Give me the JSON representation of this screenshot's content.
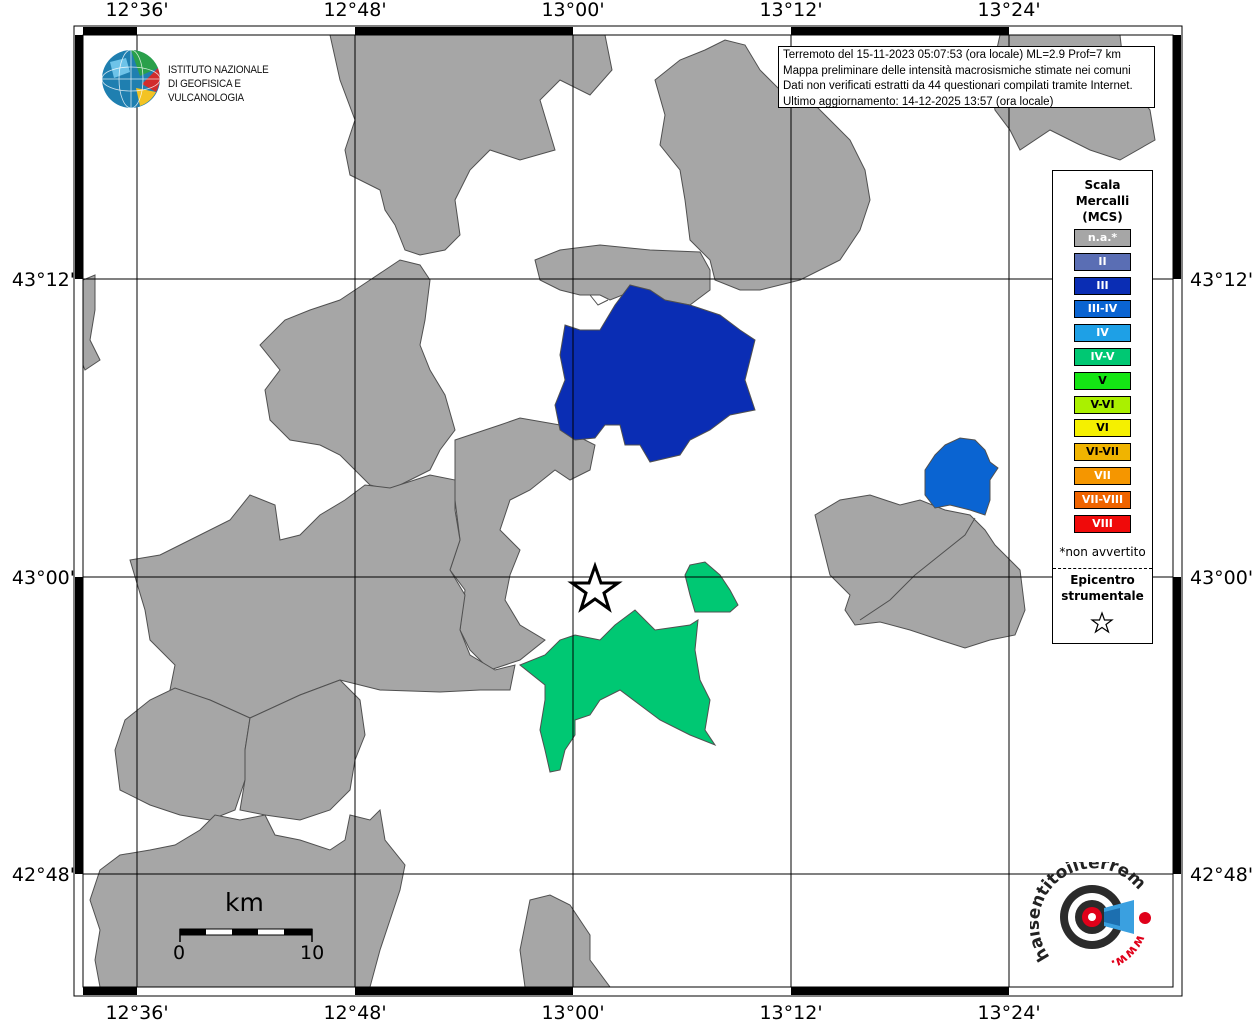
{
  "info": {
    "line1": "Terremoto del 15-11-2023 05:07:53 (ora locale) ML=2.9 Prof=7 km",
    "line2": "Mappa preliminare delle intensità macrosismiche stimate nei comuni",
    "line3": "Dati non verificati estratti da 44 questionari compilati tramite Internet.",
    "line4": "Ultimo aggiornamento: 14-12-2025 13:57 (ora locale)"
  },
  "logo": {
    "line1": "ISTITUTO NAZIONALE",
    "line2": "DI GEOFISICA E VULCANOLOGIA"
  },
  "axes": {
    "lon_labels": [
      "12°36'",
      "12°48'",
      "13°00'",
      "13°12'",
      "13°24'"
    ],
    "lat_labels": [
      "43°12'",
      "43°00'",
      "42°48'"
    ]
  },
  "legend": {
    "title1": "Scala",
    "title2": "Mercalli",
    "title3": "(MCS)",
    "classes": [
      {
        "label": "n.a.*",
        "color": "#a6a6a6"
      },
      {
        "label": "II",
        "color": "#5a6eb4"
      },
      {
        "label": "III",
        "color": "#0a2db4"
      },
      {
        "label": "III-IV",
        "color": "#0a64d2"
      },
      {
        "label": "IV",
        "color": "#1ea0e6"
      },
      {
        "label": "IV-V",
        "color": "#00c873"
      },
      {
        "label": "V",
        "color": "#14e614"
      },
      {
        "label": "V-VI",
        "color": "#aaf000"
      },
      {
        "label": "VI",
        "color": "#f5f000"
      },
      {
        "label": "VI-VII",
        "color": "#f0b400"
      },
      {
        "label": "VII",
        "color": "#f59600"
      },
      {
        "label": "VII-VIII",
        "color": "#f06400"
      },
      {
        "label": "VIII",
        "color": "#f00a0a"
      }
    ],
    "note": "*non avvertito",
    "epicentre1": "Epicentro",
    "epicentre2": "strumentale"
  },
  "scale": {
    "unit": "km",
    "min": "0",
    "max": "10"
  },
  "site": {
    "text": "haisentitoilterremoto.it",
    "url": "www."
  },
  "colors": {
    "na": "#a6a6a6",
    "iii": "#0a2db4",
    "iii_iv": "#0a64d2",
    "iv_v": "#00c873"
  }
}
